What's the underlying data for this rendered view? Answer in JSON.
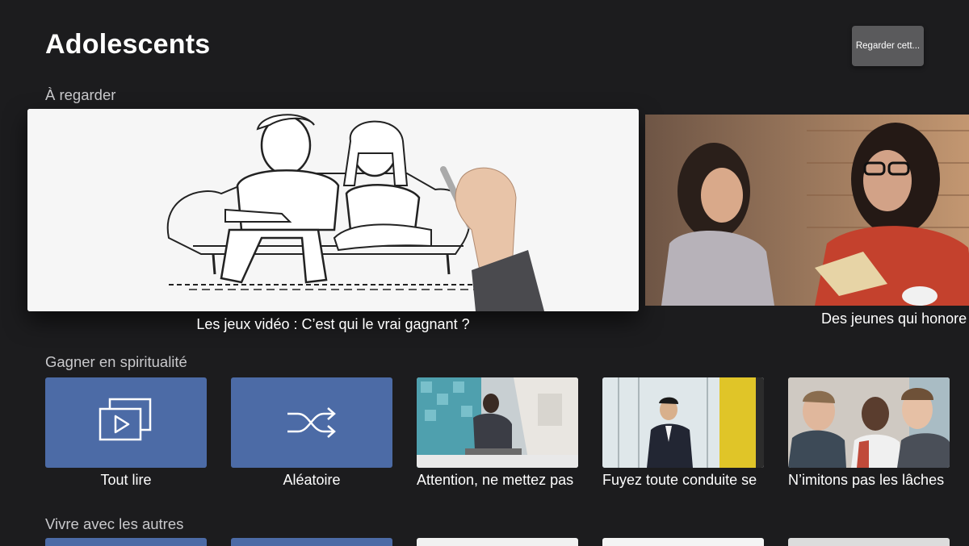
{
  "page": {
    "title": "Adolescents"
  },
  "header_button": {
    "label": "Regarder cett..."
  },
  "featured": {
    "label": "À regarder",
    "items": [
      {
        "title": "Les jeux vidéo : C’est qui le vrai gagnant ?"
      },
      {
        "title": "Des jeunes qui honore"
      }
    ]
  },
  "spirituality": {
    "label": "Gagner en spiritualité",
    "tiles": [
      {
        "title": "Tout lire",
        "icon": "play-all-icon"
      },
      {
        "title": "Aléatoire",
        "icon": "shuffle-icon"
      },
      {
        "title": "Attention, ne mettez pas"
      },
      {
        "title": "Fuyez toute conduite se"
      },
      {
        "title": "N’imitons pas les lâches"
      }
    ]
  },
  "living": {
    "label": "Vivre avec les autres"
  },
  "colors": {
    "background": "#1c1c1e",
    "tile_blue": "#4c6ba6",
    "button_gray": "#5a5a5c"
  }
}
